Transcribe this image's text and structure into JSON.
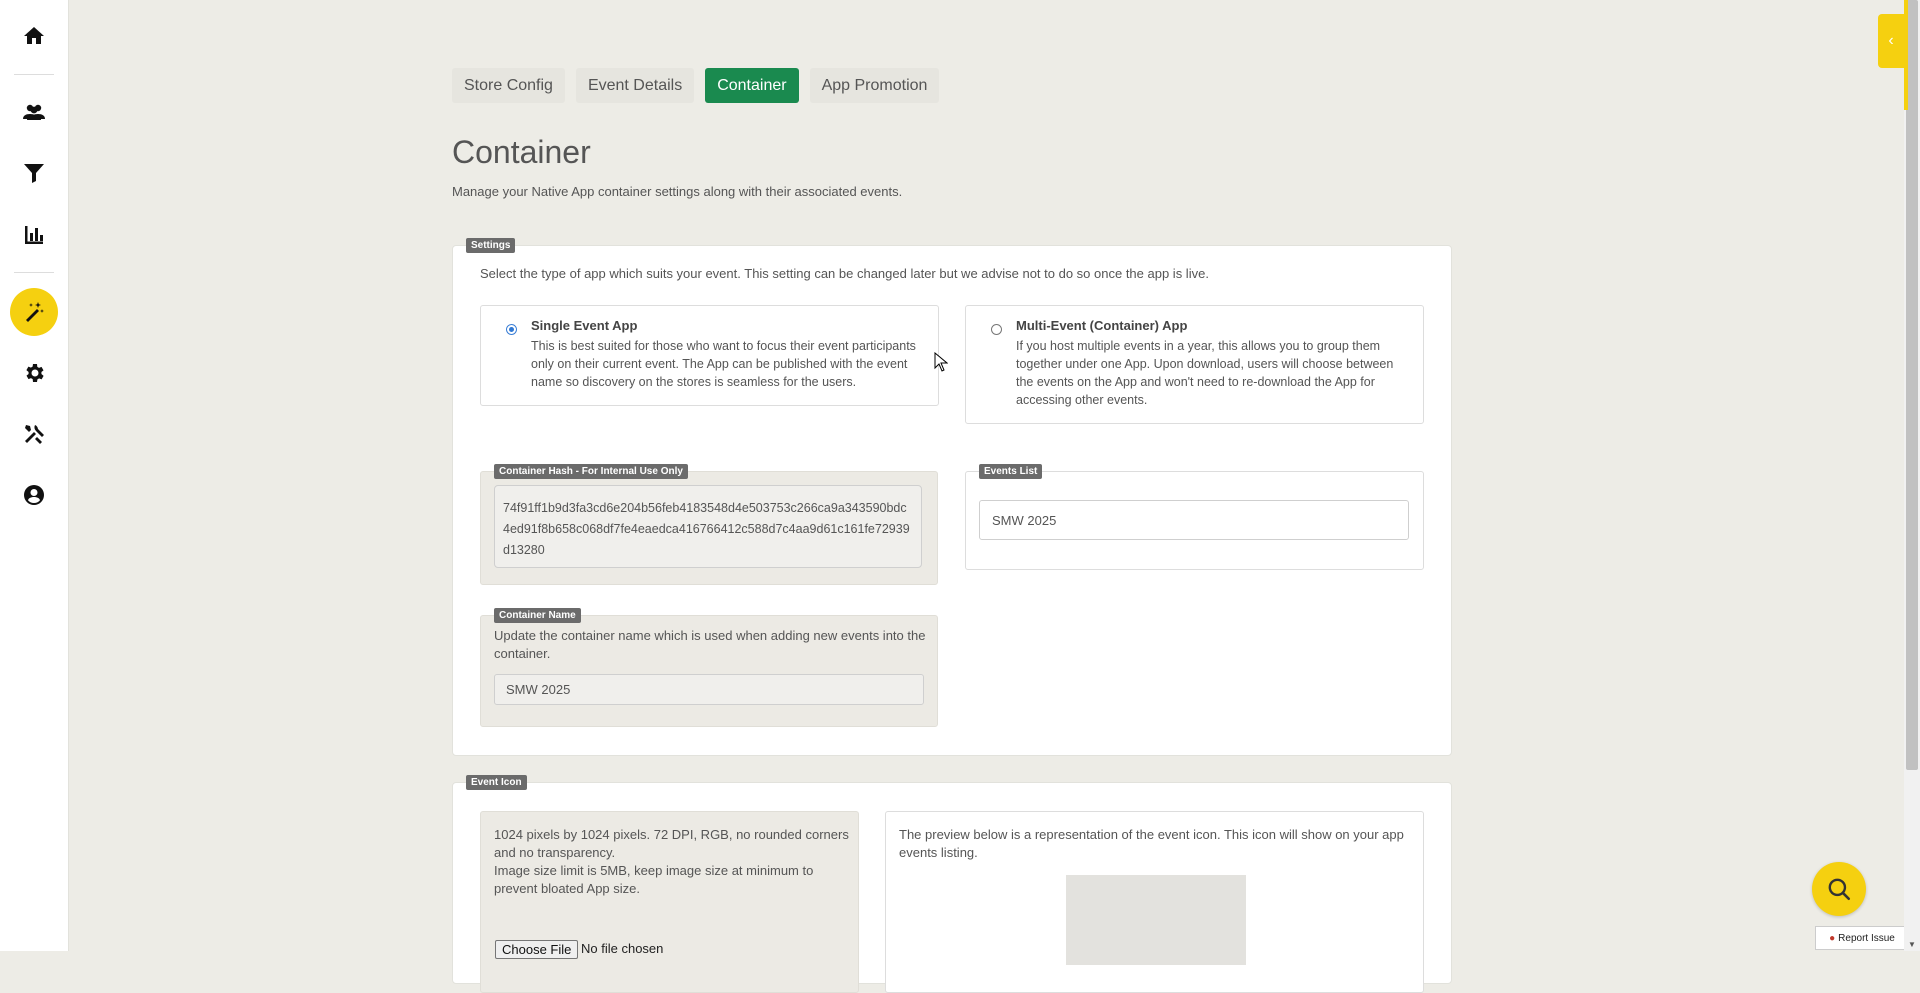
{
  "tabs": [
    {
      "label": "Store Config"
    },
    {
      "label": "Event Details"
    },
    {
      "label": "Container"
    },
    {
      "label": "App Promotion"
    }
  ],
  "page": {
    "title": "Container",
    "description": "Manage your Native App container settings along with their associated events."
  },
  "settings": {
    "legend": "Settings",
    "intro": "Select the type of app which suits your event. This setting can be changed later but we advise not to do so once the app is live.",
    "options": [
      {
        "title": "Single Event App",
        "checked": true,
        "lines": [
          "This is best suited for those who want to focus their event participants",
          "only on their current event. The App can be published with the event",
          "name so discovery on the stores is seamless for the users."
        ]
      },
      {
        "title": "Multi-Event (Container) App",
        "checked": false,
        "lines": [
          "If you host multiple events in a year, this allows you to group them",
          "together under one App. Upon download, users will choose between",
          "the events on the App and won't need to re-download the App for",
          "accessing other events."
        ]
      }
    ],
    "hash": {
      "legend": "Container Hash - For Internal Use Only",
      "value": "74f91ff1b9d3fa3cd6e204b56feb4183548d4e503753c266ca9a343590bdc4ed91f8b658c068df7fe4eaedca416766412c588d7c4aa9d61c161fe72939d13280"
    },
    "events_list": {
      "legend": "Events List",
      "value": "SMW 2025"
    },
    "container_name": {
      "legend": "Container Name",
      "help_lines": [
        "Update the container name which is used when adding new events into the",
        "container."
      ],
      "value": "SMW 2025"
    }
  },
  "event_icon": {
    "legend": "Event Icon",
    "requirements_lines": [
      "1024 pixels by 1024 pixels. 72 DPI, RGB, no rounded corners",
      "and no transparency.",
      "Image size limit is 5MB, keep image size at minimum to",
      "prevent bloated App size."
    ],
    "choose_file": "Choose File",
    "no_file": "No file chosen",
    "preview_lines": [
      "The preview below is a representation of the event icon. This icon will show on your app",
      "events listing."
    ]
  },
  "report_issue": "Report Issue",
  "colors": {
    "accent_yellow": "#f5d010",
    "active_tab_green": "#1a8a4f",
    "background": "#edece6"
  },
  "icons": {
    "sidebar": [
      "home-icon",
      "users-icon",
      "filter-icon",
      "bar-chart-icon",
      "magic-wand-icon",
      "gear-icon",
      "tools-icon",
      "user-circle-icon"
    ],
    "fab": "search-icon",
    "report": "bug-icon",
    "side_tab": "chevron-left-icon"
  }
}
